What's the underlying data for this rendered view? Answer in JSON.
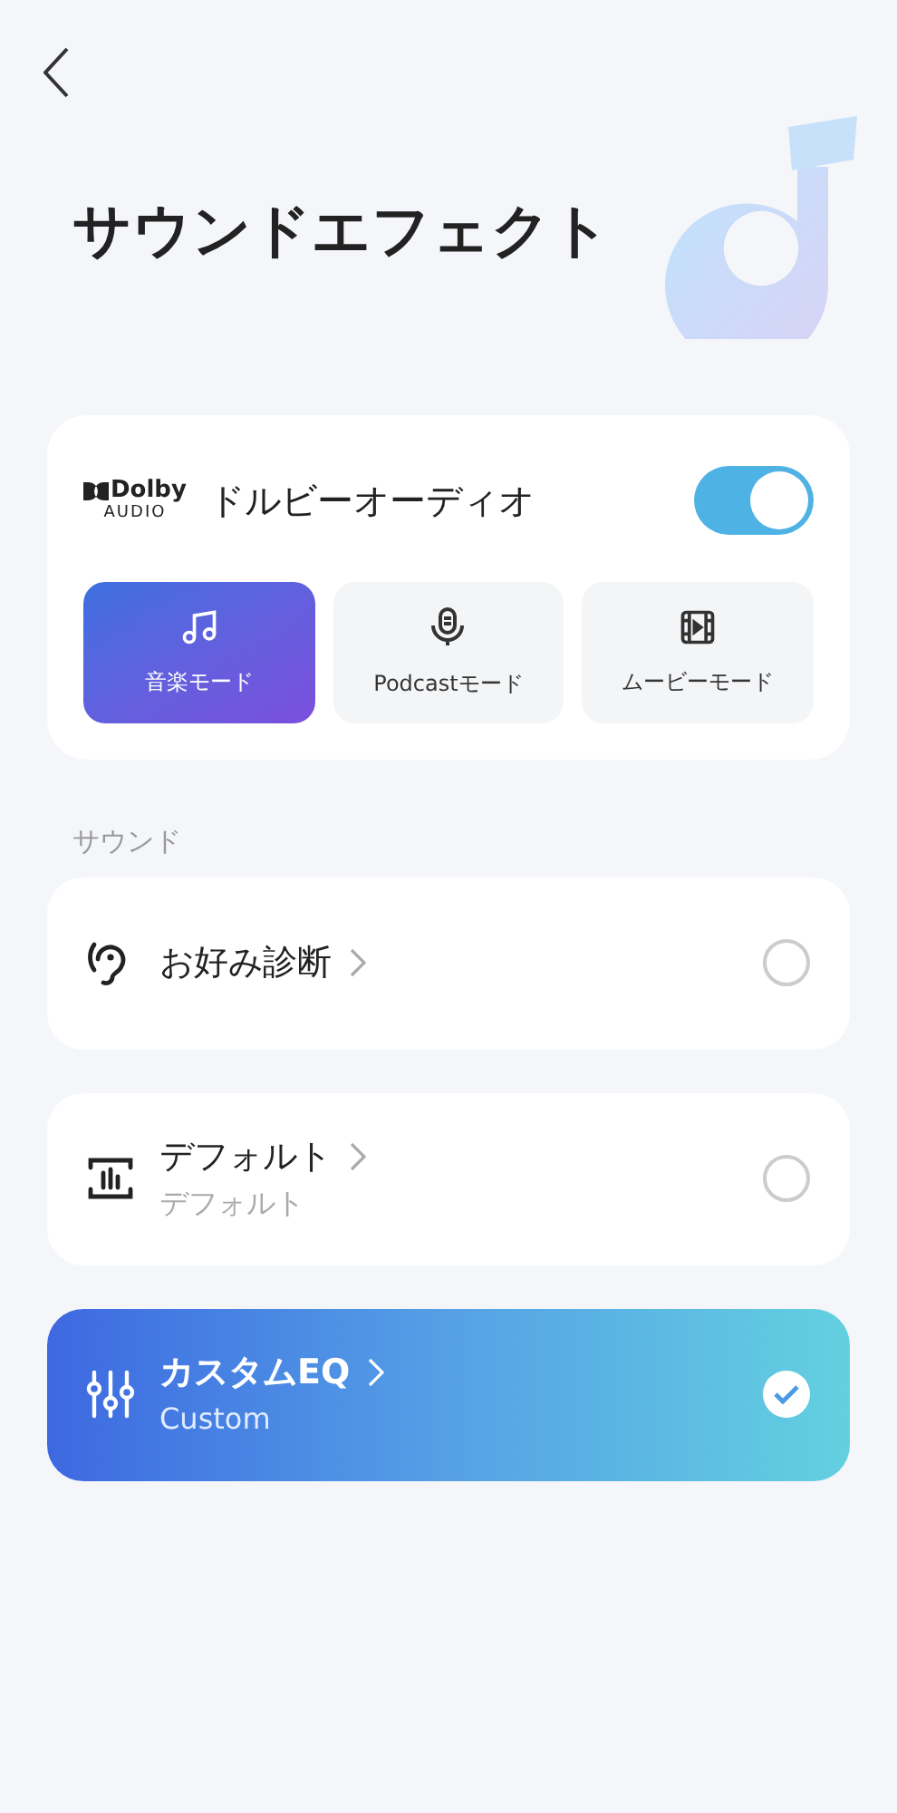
{
  "header": {
    "title": "サウンドエフェクト"
  },
  "dolby": {
    "logo_top": "Dolby",
    "logo_bottom": "AUDIO",
    "label": "ドルビーオーディオ",
    "on": true,
    "modes": [
      {
        "kind": "music",
        "label": "音楽モード",
        "selected": true
      },
      {
        "kind": "podcast",
        "label": "Podcastモード",
        "selected": false
      },
      {
        "kind": "movie",
        "label": "ムービーモード",
        "selected": false
      }
    ]
  },
  "section_label": "サウンド",
  "sound_options": [
    {
      "kind": "ear",
      "title": "お好み診断",
      "selected": false
    },
    {
      "kind": "bars",
      "title": "デフォルト",
      "subtitle": "デフォルト",
      "selected": false
    },
    {
      "kind": "sliders",
      "title": "カスタムEQ",
      "subtitle": "Custom",
      "selected": true
    }
  ]
}
